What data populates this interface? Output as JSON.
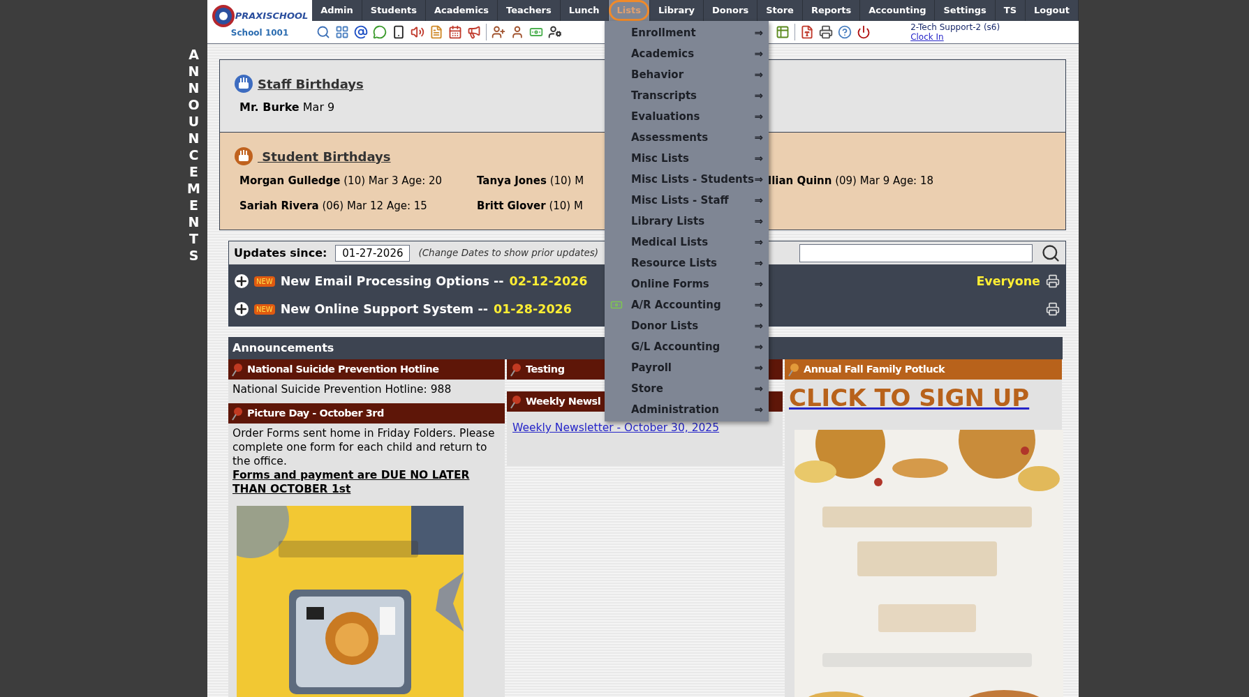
{
  "sidebar_label": "ANNOUNCEMENTS",
  "logo": {
    "brand": "PRAXISCHOOL",
    "school": "School 1001"
  },
  "nav": [
    {
      "label": "Admin",
      "selected": false
    },
    {
      "label": "Students",
      "selected": false
    },
    {
      "label": "Academics",
      "selected": false
    },
    {
      "label": "Teachers",
      "selected": false
    },
    {
      "label": "Lunch",
      "selected": false
    },
    {
      "label": "Lists",
      "selected": true
    },
    {
      "label": "Library",
      "selected": false
    },
    {
      "label": "Donors",
      "selected": false
    },
    {
      "label": "Store",
      "selected": false
    },
    {
      "label": "Reports",
      "selected": false
    },
    {
      "label": "Accounting",
      "selected": false
    },
    {
      "label": "Settings",
      "selected": false
    },
    {
      "label": "TS",
      "selected": false
    },
    {
      "label": "Logout",
      "selected": false
    }
  ],
  "user": {
    "name": "2-Tech Support-2 (s6)",
    "clock_link": "Clock In"
  },
  "staff_birthdays": {
    "title": "Staff Birthdays",
    "entries": [
      "**Mr. Burke** Mar 9"
    ]
  },
  "student_birthdays": {
    "title": " Student Birthdays",
    "entries": [
      "**Morgan Gulledge** (10) Mar 3 Age: 20",
      "**Tanya Jones** (10) M",
      "**llian Quinn** (09) Mar 9 Age: 18",
      "**Sariah Rivera** (06) Mar 12 Age: 15",
      "**Britt Glover** (10) M"
    ]
  },
  "updates": {
    "label": "Updates since:",
    "date": "01-27-2026",
    "hint": "(Change Dates to show prior updates)",
    "items": [
      {
        "badge": "NEW",
        "title": "New Email Processing Options --",
        "date": "02-12-2026",
        "audience": "Everyone"
      },
      {
        "badge": "NEW",
        "title": "New Online Support System --",
        "date": "01-28-2026"
      }
    ]
  },
  "announcements": {
    "title": "Announcements",
    "columns": [
      [
        {
          "title": "National Suicide Prevention Hotline",
          "color": "#5e1608",
          "body": [
            "National Suicide Prevention Hotline: 988"
          ]
        },
        {
          "title": "Picture Day - October 3rd",
          "color": "#5e1608",
          "body": [
            "Order Forms sent home in Friday Folders. Please complete one form for each child and return to the office."
          ],
          "notice": "Forms and payment are DUE NO LATER THAN OCTOBER 1st",
          "picture": {
            "kind": "picture"
          }
        }
      ],
      [
        {
          "title": "Testing",
          "color": "#5e1608"
        },
        {
          "title": "Weekly Newsl",
          "color": "#5e1608",
          "link": "Weekly Newsletter - October 30, 2025"
        }
      ],
      [
        {
          "title": "Annual Fall Family Potluck",
          "color": "#b8621b",
          "big_link": "CLICK TO SIGN UP",
          "picture": {
            "kind": "picture"
          }
        }
      ]
    ]
  },
  "menu": {
    "items": [
      {
        "label": "Enrollment",
        "arrow": "⇒",
        "kind": "plain"
      },
      {
        "label": "Academics",
        "arrow": "⇒",
        "kind": "plain"
      },
      {
        "label": "Behavior",
        "arrow": "⇒",
        "kind": "plain"
      },
      {
        "label": "Transcripts",
        "arrow": "⇒",
        "kind": "plain"
      },
      {
        "label": "Evaluations",
        "arrow": "⇒",
        "kind": "plain"
      },
      {
        "label": "Assessments",
        "arrow": "⇒",
        "kind": "plain"
      },
      {
        "label": "Misc Lists",
        "arrow": "⇒",
        "kind": "plain"
      },
      {
        "label": "Misc Lists - Students",
        "arrow": "⇒",
        "kind": "plain"
      },
      {
        "label": "Misc Lists - Staff",
        "arrow": "⇒",
        "kind": "plain"
      },
      {
        "label": "Library Lists",
        "arrow": "⇒",
        "kind": "plain"
      },
      {
        "label": "Medical Lists",
        "arrow": "⇒",
        "kind": "plain"
      },
      {
        "label": "Resource Lists",
        "arrow": "⇒",
        "kind": "plain"
      },
      {
        "label": "Online Forms",
        "arrow": "⇒",
        "kind": "plain"
      },
      {
        "label": "A/R Accounting",
        "arrow": "⇒",
        "kind": "money"
      },
      {
        "label": "Donor Lists",
        "arrow": "⇒",
        "kind": "plain"
      },
      {
        "label": "G/L Accounting",
        "arrow": "⇒",
        "kind": "plain"
      },
      {
        "label": "Payroll",
        "arrow": "⇒",
        "kind": "plain"
      },
      {
        "label": "Store",
        "arrow": "⇒",
        "kind": "plain"
      },
      {
        "label": "Administration",
        "arrow": "⇒",
        "kind": "plain"
      }
    ]
  }
}
